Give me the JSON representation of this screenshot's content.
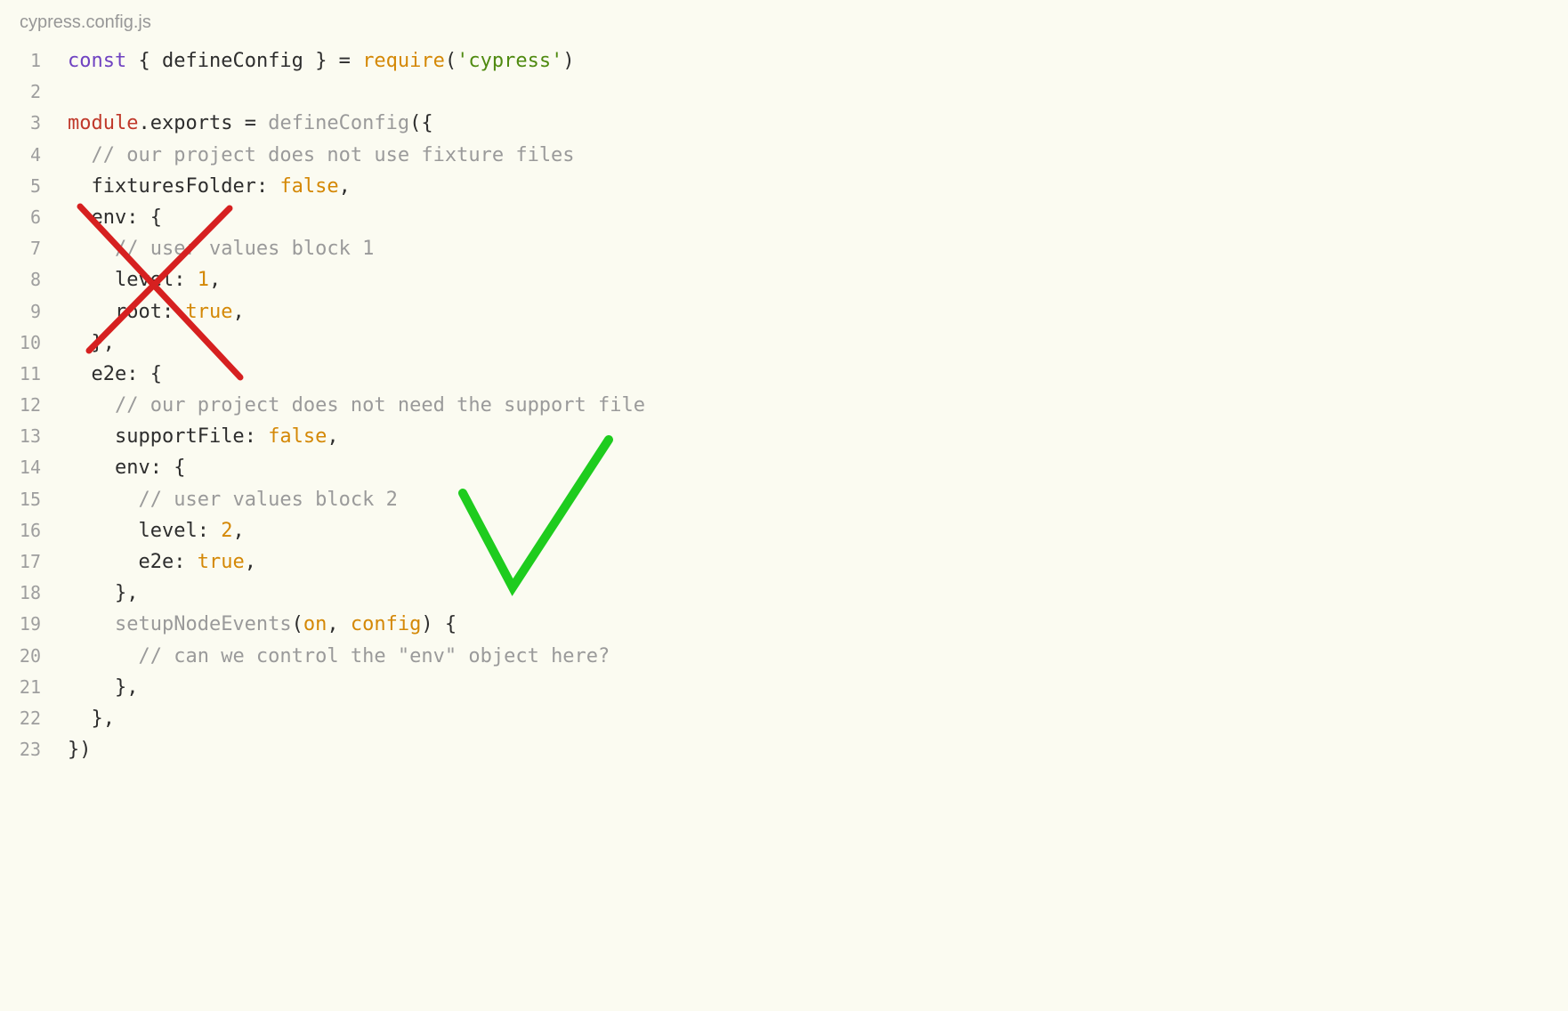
{
  "filename": "cypress.config.js",
  "lines": {
    "l1": {
      "n": "1"
    },
    "l2": {
      "n": "2"
    },
    "l3": {
      "n": "3"
    },
    "l4": {
      "n": "4"
    },
    "l5": {
      "n": "5"
    },
    "l6": {
      "n": "6"
    },
    "l7": {
      "n": "7"
    },
    "l8": {
      "n": "8"
    },
    "l9": {
      "n": "9"
    },
    "l10": {
      "n": "10"
    },
    "l11": {
      "n": "11"
    },
    "l12": {
      "n": "12"
    },
    "l13": {
      "n": "13"
    },
    "l14": {
      "n": "14"
    },
    "l15": {
      "n": "15"
    },
    "l16": {
      "n": "16"
    },
    "l17": {
      "n": "17"
    },
    "l18": {
      "n": "18"
    },
    "l19": {
      "n": "19"
    },
    "l20": {
      "n": "20"
    },
    "l21": {
      "n": "21"
    },
    "l22": {
      "n": "22"
    },
    "l23": {
      "n": "23"
    }
  },
  "tok": {
    "const": "const",
    "sp": " ",
    "lbrace": "{",
    "rbrace": "}",
    "defineConfig": "defineConfig",
    "eq": " = ",
    "require": "require",
    "lp": "(",
    "rp": ")",
    "cypress_str": "'cypress'",
    "module": "module",
    "dot": ".",
    "exports": "exports",
    "lbrace_only": "{",
    "comment_fixtures": "// our project does not use fixture files",
    "fixturesFolder": "fixturesFolder",
    "colon": ": ",
    "false": "false",
    "comma": ",",
    "env": "env",
    "comment_block1": "// user values block 1",
    "level": "level",
    "one": "1",
    "root": "root",
    "true": "true",
    "e2e": "e2e",
    "comment_support": "// our project does not need the support file",
    "supportFile": "supportFile",
    "comment_block2": "// user values block 2",
    "two": "2",
    "setupNodeEvents": "setupNodeEvents",
    "on": "on",
    "config_param": "config",
    "comma_sp": ", ",
    "comment_env_q": "// can we control the \"env\" object here?",
    "rbrace_comma": "},",
    "rbrace_rp": "})"
  },
  "indent": {
    "i1": "  ",
    "i2": "    ",
    "i3": "      "
  }
}
